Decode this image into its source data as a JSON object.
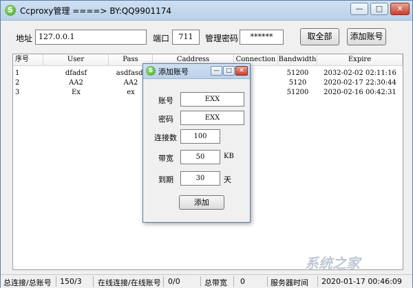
{
  "window": {
    "title": "Ccproxy管理 ====> BY:QQ9901174",
    "controls": {
      "minimize": "—",
      "maximize": "□",
      "close": "✕"
    }
  },
  "toolbar": {
    "address_label": "地址",
    "address_value": "127.0.0.1",
    "port_label": "端口",
    "port_value": "711",
    "password_label": "管理密码",
    "password_value": "******",
    "fetch_all_button": "取全部",
    "add_account_button": "添加账号"
  },
  "table": {
    "headers": [
      "序号",
      "User",
      "Pass",
      "Caddress",
      "Connection",
      "Bandwidth",
      "Expire"
    ],
    "rows": [
      [
        "1",
        "dfadsf",
        "asdfasdf",
        "",
        "",
        "51200",
        "2032-02-02 02:11:16"
      ],
      [
        "2",
        "AA2",
        "AA2",
        "",
        "",
        "5120",
        "2020-02-17 22:30:44"
      ],
      [
        "3",
        "Ex",
        "ex",
        "",
        "",
        "51200",
        "2020-02-16 00:42:31"
      ]
    ]
  },
  "status": {
    "conn_label": "总连接/总账号",
    "conn_value": "150/3",
    "online_label": "在线连接/在线账号",
    "online_value": "0/0",
    "bandwidth_label": "总带宽",
    "bandwidth_value": "0",
    "server_time_label": "服务器时间",
    "server_time_value": "2020-01-17 00:46:09"
  },
  "dialog": {
    "title": "添加账号",
    "account_label": "账号",
    "account_value": "EXX",
    "password_label": "密码",
    "password_value": "EXX",
    "conn_label": "连接数",
    "conn_value": "100",
    "bandwidth_label": "带宽",
    "bandwidth_value": "50",
    "bandwidth_unit": "KB",
    "expire_label": "到期",
    "expire_value": "30",
    "expire_unit": "天",
    "add_button": "添加",
    "controls": {
      "minimize": "—",
      "maximize": "□",
      "close": "✕"
    }
  },
  "icon": {
    "app_icon": "ccproxy-logo-icon"
  },
  "watermark": {
    "text": "系统之家"
  }
}
